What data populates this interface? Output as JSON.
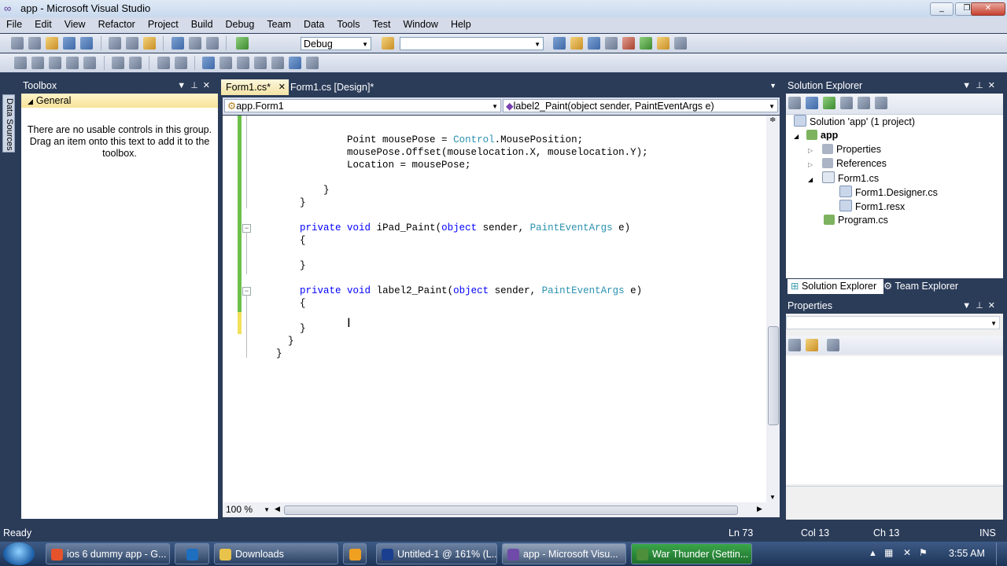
{
  "window": {
    "title": "app - Microsoft Visual Studio",
    "minimize": "_",
    "maximize": "❐",
    "close": "✕",
    "app_icon": "∞"
  },
  "menu": [
    "File",
    "Edit",
    "View",
    "Refactor",
    "Project",
    "Build",
    "Debug",
    "Team",
    "Data",
    "Tools",
    "Test",
    "Window",
    "Help"
  ],
  "toolbar": {
    "config": "Debug",
    "platform": ""
  },
  "datasources": {
    "label": "Data Sources"
  },
  "toolbox": {
    "title": "Toolbox",
    "group": "General",
    "message": "There are no usable controls in this group. Drag an item onto this text to add it to the toolbox."
  },
  "editor": {
    "tabs": [
      {
        "label": "Form1.cs*",
        "close": "✕"
      },
      {
        "label": "Form1.cs [Design]*"
      }
    ],
    "nav_left": "app.Form1",
    "nav_right": "label2_Paint(object sender, PaintEventArgs e)",
    "zoom": "100 %",
    "lines": [
      {
        "indent": "            ",
        "parts": [
          {
            "t": "Point",
            "c": ""
          },
          {
            "t": " mousePose = ",
            "c": ""
          },
          {
            "t": "Control",
            "c": "ty"
          },
          {
            "t": ".MousePosition;",
            "c": ""
          }
        ]
      },
      {
        "indent": "            ",
        "parts": [
          {
            "t": "mousePose.Offset(mouselocation.X, mouselocation.Y);",
            "c": ""
          }
        ]
      },
      {
        "indent": "            ",
        "parts": [
          {
            "t": "Location = mousePose;",
            "c": ""
          }
        ]
      },
      {
        "indent": "",
        "parts": []
      },
      {
        "indent": "        ",
        "parts": [
          {
            "t": "}",
            "c": ""
          }
        ]
      },
      {
        "indent": "    ",
        "parts": [
          {
            "t": "}",
            "c": ""
          }
        ]
      },
      {
        "indent": "",
        "parts": []
      },
      {
        "indent": "    ",
        "parts": [
          {
            "t": "private",
            "c": "kw"
          },
          {
            "t": " ",
            "c": ""
          },
          {
            "t": "void",
            "c": "kw"
          },
          {
            "t": " iPad_Paint(",
            "c": ""
          },
          {
            "t": "object",
            "c": "kw"
          },
          {
            "t": " sender, ",
            "c": ""
          },
          {
            "t": "PaintEventArgs",
            "c": "ty"
          },
          {
            "t": " e)",
            "c": ""
          }
        ]
      },
      {
        "indent": "    ",
        "parts": [
          {
            "t": "{",
            "c": ""
          }
        ]
      },
      {
        "indent": "",
        "parts": []
      },
      {
        "indent": "    ",
        "parts": [
          {
            "t": "}",
            "c": ""
          }
        ]
      },
      {
        "indent": "",
        "parts": []
      },
      {
        "indent": "    ",
        "parts": [
          {
            "t": "private",
            "c": "kw"
          },
          {
            "t": " ",
            "c": ""
          },
          {
            "t": "void",
            "c": "kw"
          },
          {
            "t": " label2_Paint(",
            "c": ""
          },
          {
            "t": "object",
            "c": "kw"
          },
          {
            "t": " sender, ",
            "c": ""
          },
          {
            "t": "PaintEventArgs",
            "c": "ty"
          },
          {
            "t": " e)",
            "c": ""
          }
        ]
      },
      {
        "indent": "    ",
        "parts": [
          {
            "t": "{",
            "c": ""
          }
        ]
      },
      {
        "indent": "",
        "parts": []
      },
      {
        "indent": "    ",
        "parts": [
          {
            "t": "}",
            "c": ""
          }
        ]
      },
      {
        "indent": "  ",
        "parts": [
          {
            "t": "}",
            "c": ""
          }
        ]
      },
      {
        "indent": "",
        "parts": [
          {
            "t": "}",
            "c": ""
          }
        ]
      }
    ]
  },
  "solution_explorer": {
    "title": "Solution Explorer",
    "items": [
      {
        "label": "Solution 'app' (1 project)",
        "expander": ""
      },
      {
        "label": "app",
        "expander": "◢"
      },
      {
        "label": "Properties",
        "expander": "▷"
      },
      {
        "label": "References",
        "expander": "▷"
      },
      {
        "label": "Form1.cs",
        "expander": "◢"
      },
      {
        "label": "Form1.Designer.cs",
        "expander": ""
      },
      {
        "label": "Form1.resx",
        "expander": ""
      },
      {
        "label": "Program.cs",
        "expander": ""
      }
    ],
    "tabs": [
      "Solution Explorer",
      "Team Explorer"
    ]
  },
  "properties": {
    "title": "Properties"
  },
  "status": {
    "ready": "Ready",
    "ln": "Ln 73",
    "col": "Col 13",
    "ch": "Ch 13",
    "mode": "INS"
  },
  "taskbar": {
    "items": [
      {
        "label": "ios 6 dummy app - G...",
        "icon_color": "#e5532d"
      },
      {
        "label": "",
        "icon_color": "#1f6fc1"
      },
      {
        "label": "Downloads",
        "icon_color": "#e8c24a"
      },
      {
        "label": "",
        "icon_color": "#f0a020"
      },
      {
        "label": "Untitled-1 @ 161% (L...",
        "icon_color": "#1b3f8f"
      },
      {
        "label": "app - Microsoft Visu...",
        "icon_color": "#6f4aa8"
      },
      {
        "label": "War Thunder (Settin...",
        "icon_color": "#4d8f3a"
      }
    ],
    "clock": "3:55 AM"
  }
}
